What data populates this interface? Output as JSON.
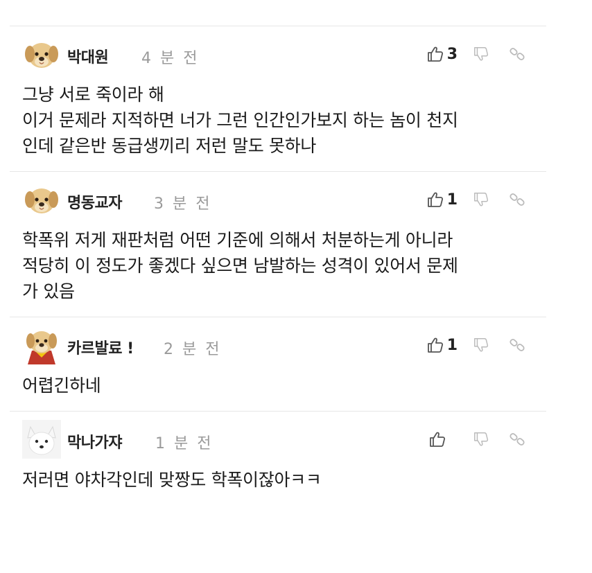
{
  "comments": [
    {
      "nickname": "박대원",
      "time": "4 분 전",
      "likes": "3",
      "avatar": "puppy-icon",
      "lines": [
        "그냥 서로 죽이라 해",
        "이거 문제라 지적하면 너가 그런 인간인가보지 하는 놈이 천지",
        "인데 같은반 동급생끼리 저런 말도 못하나"
      ]
    },
    {
      "nickname": "명동교자",
      "time": "3 분 전",
      "likes": "1",
      "avatar": "puppy-icon",
      "lines": [
        "학폭위 저게 재판처럼 어떤 기준에 의해서 처분하는게 아니라",
        "적당히 이 정도가 좋겠다 싶으면 남발하는 성격이 있어서 문제",
        "가 있음"
      ]
    },
    {
      "nickname": "카르발료 !",
      "time": "2 분 전",
      "likes": "1",
      "avatar": "puppy-cape-icon",
      "lines": [
        "어렵긴하네"
      ]
    },
    {
      "nickname": "막나가쟈",
      "time": "1 분 전",
      "likes": "",
      "avatar": "white-fox-icon",
      "lines": [
        "저러면 야차각인데 맞짱도 학폭이잖아ㅋㅋ"
      ]
    }
  ],
  "colors": {
    "nickname": "#222222",
    "time": "#9a9a9a",
    "icon": "#555555",
    "divider": "#e6e6e6"
  }
}
